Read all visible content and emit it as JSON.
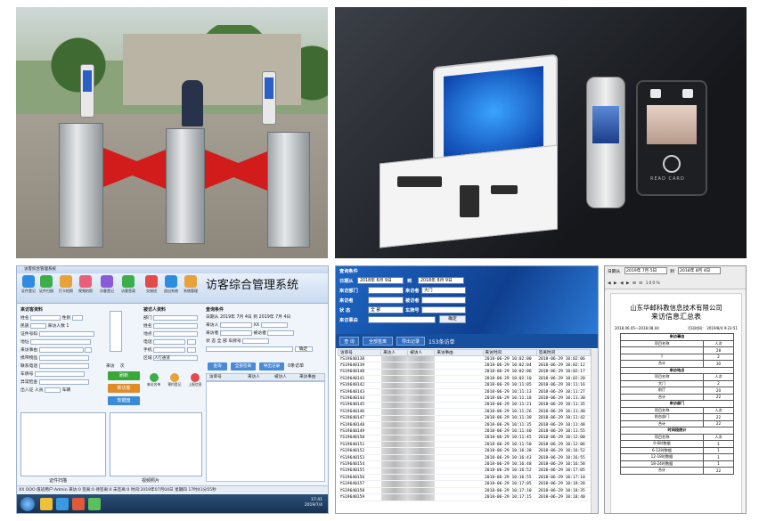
{
  "p1": {
    "caption": ""
  },
  "p2": {
    "brand_small": "讯 C",
    "pad_label": "READ CARD"
  },
  "app": {
    "window_title": "访客综合管理系统",
    "app_title": "访客综合管理系统",
    "toolbar": [
      "证件登记",
      "证件扫描",
      "打卡拍照",
      "视频拍照",
      "访客登记",
      "访客签离",
      "交接班",
      "退出系统",
      "系统管理"
    ],
    "visitor_section": "来访客资料",
    "visited_section": "被访人资料",
    "query_section": "查询条件",
    "visitor_fields": [
      "姓名",
      "民族",
      "证件号码",
      "地址",
      "来访事由",
      "携带物品",
      "联系电话",
      "车牌号",
      "异常检查",
      "出入证"
    ],
    "visitor_extra": {
      "gender": "性别",
      "count": "来访人数",
      "count_val": "1",
      "person": "人员",
      "vehicle": "车辆"
    },
    "visited_fields": [
      "部门",
      "姓名",
      "地点",
      "电话",
      "手机",
      "区域"
    ],
    "area_val": "人行通道",
    "visit_btn": "来访",
    "times": "次",
    "query_fields": {
      "date_from": "日期从",
      "date1": "2019年 7月 4日",
      "to": "到",
      "date2": "2019年 7月 4日",
      "visitor": "来访人",
      "visitor_val": "XX",
      "visitor2": "来访者",
      "visited": "被访者",
      "status": "状 态",
      "status_val": "全 部",
      "plate": "车牌号",
      "confirm": "确定"
    },
    "query_tabs": [
      "查询",
      "全部签离",
      "导出记录"
    ],
    "query_count": "0条访单",
    "big_buttons": [
      "刷新",
      "新访客",
      "软键盘"
    ],
    "small_icons": [
      "来访名单",
      "预约登记",
      "上报信息"
    ],
    "tbl_cols": [
      "访单号",
      "来访人",
      "被访人",
      "来访事由"
    ],
    "bottom_labels": [
      "证件扫描",
      "视频照片"
    ],
    "status_text": "XX OOO  值班用户:Admin  来访:0  签离:0  待签离:0  未签离:0  时间:2019年07月04日 星期四  17时41分55秒",
    "clock_time": "17:41",
    "clock_date": "2019/7/4"
  },
  "query": {
    "label_date": "日期从",
    "from": "2018年 6月 9日",
    "to_label": "到",
    "to": "2018年 8月 9日",
    "f1": "来访部门",
    "f1v": "",
    "f2": "来访者",
    "f2v": "大门",
    "f3": "来访者",
    "f4": "被访者",
    "f5": "状 态",
    "f5v": "全 部",
    "f6": "车牌号",
    "f7": "来访事由",
    "btn_confirm": "确定",
    "tabs": [
      "查 询",
      "全部签离",
      "导出记录"
    ],
    "count": "153条访单",
    "columns": [
      "访单号",
      "来访人",
      "被访人",
      "来访事由",
      "来访时间",
      "签离时间"
    ],
    "rows": [
      [
        "YS19640138",
        "",
        "",
        "",
        "2018-06-29 10:02:00",
        "2018-06-29 10:02:06"
      ],
      [
        "YS19640139",
        "",
        "",
        "",
        "2018-06-29 10:02:04",
        "2018-06-29 10:02:12"
      ],
      [
        "YS19640140",
        "",
        "",
        "",
        "2018-06-29 10:02:06",
        "2018-06-29 10:02:17"
      ],
      [
        "YS19640141",
        "",
        "",
        "",
        "2018-06-29 10:02:10",
        "2018-06-29 10:02:20"
      ],
      [
        "YS19640142",
        "",
        "",
        "",
        "2018-06-29 10:11:05",
        "2018-06-29 10:11:16"
      ],
      [
        "YS19640143",
        "",
        "",
        "",
        "2018-06-29 10:11:13",
        "2018-06-29 10:11:27"
      ],
      [
        "YS19640144",
        "",
        "",
        "",
        "2018-06-29 10:11:18",
        "2018-06-29 10:11:30"
      ],
      [
        "YS19640145",
        "",
        "",
        "",
        "2018-06-29 10:11:21",
        "2018-06-29 10:11:35"
      ],
      [
        "YS19640146",
        "",
        "",
        "",
        "2018-06-29 10:11:26",
        "2018-06-29 10:11:40"
      ],
      [
        "YS19640147",
        "",
        "",
        "",
        "2018-06-29 10:11:30",
        "2018-06-29 10:11:42"
      ],
      [
        "YS19640148",
        "",
        "",
        "",
        "2018-06-29 10:11:35",
        "2018-06-29 10:11:48"
      ],
      [
        "YS19640149",
        "",
        "",
        "",
        "2018-06-29 10:11:40",
        "2018-06-29 10:11:55"
      ],
      [
        "YS19640150",
        "",
        "",
        "",
        "2018-06-29 10:11:45",
        "2018-06-29 10:12:00"
      ],
      [
        "YS19640151",
        "",
        "",
        "",
        "2018-06-29 10:11:50",
        "2018-06-29 10:12:06"
      ],
      [
        "YS19640152",
        "",
        "",
        "",
        "2018-06-29 10:16:38",
        "2018-06-29 10:16:52"
      ],
      [
        "YS19640153",
        "",
        "",
        "",
        "2018-06-29 10:16:43",
        "2018-06-29 10:16:55"
      ],
      [
        "YS19640154",
        "",
        "",
        "",
        "2018-06-29 10:16:48",
        "2018-06-29 10:16:58"
      ],
      [
        "YS19640155",
        "",
        "",
        "",
        "2018-06-29 10:16:52",
        "2018-06-29 10:17:05"
      ],
      [
        "YS19640156",
        "",
        "",
        "",
        "2018-06-29 10:16:55",
        "2018-06-29 10:17:10"
      ],
      [
        "YS19640157",
        "",
        "",
        "",
        "2018-06-29 10:17:05",
        "2018-06-29 10:18:28"
      ],
      [
        "YS19640158",
        "",
        "",
        "",
        "2018-06-29 10:17:10",
        "2018-06-29 10:18:35"
      ],
      [
        "YS19640159",
        "",
        "",
        "",
        "2018-06-29 10:17:15",
        "2018-06-29 10:18:40"
      ]
    ]
  },
  "report": {
    "date_label": "日期从",
    "from": "2019年 7月 5日",
    "to_label": "到",
    "to": "2018年 8月 4日",
    "toolbar": "◀ ▶ ◀ ▶ ⊞ ⊟ 100%",
    "company": "山东华邮科教信息技术有限公司",
    "title": "来访信息汇总表",
    "meta_left": "2018.06.05—2018.08.04",
    "meta_right": "打印时间： 2019/8/4 9:23:51",
    "rows": [
      [
        "来访事由",
        ""
      ],
      [
        "项目名称",
        "人次"
      ],
      [
        "",
        "28"
      ],
      [
        "?",
        "2"
      ],
      [
        "合计",
        "30"
      ],
      [
        "来访地点",
        ""
      ],
      [
        "项目名称",
        "人次"
      ],
      [
        "大门",
        "2"
      ],
      [
        "前厅",
        "20"
      ],
      [
        "合计",
        "22"
      ],
      [
        "来访部门",
        ""
      ],
      [
        "项目名称",
        "人次"
      ],
      [
        "前台部门",
        "22"
      ],
      [
        "合计",
        "22"
      ],
      [
        "时间段统计",
        ""
      ],
      [
        "项目名称",
        "人次"
      ],
      [
        "0-6时数据",
        "1"
      ],
      [
        "6-12时数据",
        "1"
      ],
      [
        "12-18时数据",
        "1"
      ],
      [
        "18-24时数据",
        "1"
      ],
      [
        "合计",
        "22"
      ]
    ]
  },
  "colors": {
    "wing_red": "#d21c1c",
    "app_blue": "#1d66c4",
    "green_btn": "#38a838"
  }
}
